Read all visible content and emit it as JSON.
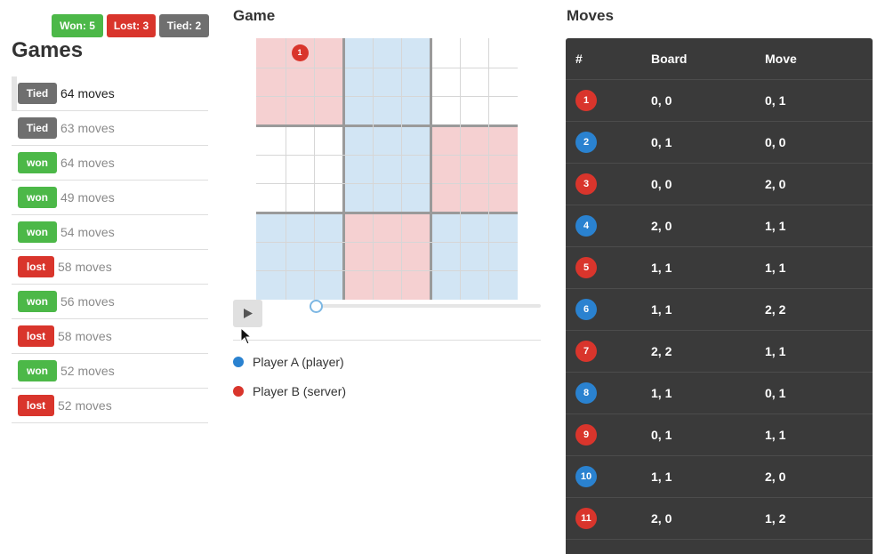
{
  "stats": {
    "won": "Won: 5",
    "lost": "Lost: 3",
    "tied": "Tied: 2"
  },
  "games": {
    "title": "Games",
    "items": [
      {
        "result": "Tied",
        "kind": "tied",
        "moves": "64 moves",
        "active": true
      },
      {
        "result": "Tied",
        "kind": "tied",
        "moves": "63 moves",
        "active": false
      },
      {
        "result": "won",
        "kind": "won",
        "moves": "64 moves",
        "active": false
      },
      {
        "result": "won",
        "kind": "won",
        "moves": "49 moves",
        "active": false
      },
      {
        "result": "won",
        "kind": "won",
        "moves": "54 moves",
        "active": false
      },
      {
        "result": "lost",
        "kind": "lost",
        "moves": "58 moves",
        "active": false
      },
      {
        "result": "won",
        "kind": "won",
        "moves": "56 moves",
        "active": false
      },
      {
        "result": "lost",
        "kind": "lost",
        "moves": "58 moves",
        "active": false
      },
      {
        "result": "won",
        "kind": "won",
        "moves": "52 moves",
        "active": false
      },
      {
        "result": "lost",
        "kind": "lost",
        "moves": "52 moves",
        "active": false
      }
    ]
  },
  "game": {
    "title": "Game",
    "board": {
      "boxes": [
        [
          "red",
          "blue",
          "none"
        ],
        [
          "none",
          "blue",
          "red"
        ],
        [
          "blue",
          "red",
          "blue"
        ]
      ],
      "current_move": {
        "label": "1",
        "board": [
          0,
          0
        ],
        "cell": [
          0,
          1
        ],
        "player": "red"
      }
    },
    "play_icon": "play-icon",
    "slider_position": 0,
    "legend": [
      {
        "label": "Player A (player)",
        "color": "#2a82d0"
      },
      {
        "label": "Player B (server)",
        "color": "#d9352c"
      }
    ]
  },
  "moves": {
    "title": "Moves",
    "headers": [
      "#",
      "Board",
      "Move"
    ],
    "rows": [
      {
        "num": "1",
        "player": "red",
        "board": "0, 0",
        "move": "0, 1"
      },
      {
        "num": "2",
        "player": "blue",
        "board": "0, 1",
        "move": "0, 0"
      },
      {
        "num": "3",
        "player": "red",
        "board": "0, 0",
        "move": "2, 0"
      },
      {
        "num": "4",
        "player": "blue",
        "board": "2, 0",
        "move": "1, 1"
      },
      {
        "num": "5",
        "player": "red",
        "board": "1, 1",
        "move": "1, 1"
      },
      {
        "num": "6",
        "player": "blue",
        "board": "1, 1",
        "move": "2, 2"
      },
      {
        "num": "7",
        "player": "red",
        "board": "2, 2",
        "move": "1, 1"
      },
      {
        "num": "8",
        "player": "blue",
        "board": "1, 1",
        "move": "0, 1"
      },
      {
        "num": "9",
        "player": "red",
        "board": "0, 1",
        "move": "1, 1"
      },
      {
        "num": "10",
        "player": "blue",
        "board": "1, 1",
        "move": "2, 0"
      },
      {
        "num": "11",
        "player": "red",
        "board": "2, 0",
        "move": "1, 2"
      }
    ]
  },
  "colors": {
    "won": "#4cb848",
    "lost": "#d9352c",
    "tied": "#6f6f6f",
    "player_a": "#2a82d0",
    "player_b": "#d9352c",
    "box_red": "#f5d0d1",
    "box_blue": "#d2e5f4",
    "panel": "#3a3a3a"
  }
}
